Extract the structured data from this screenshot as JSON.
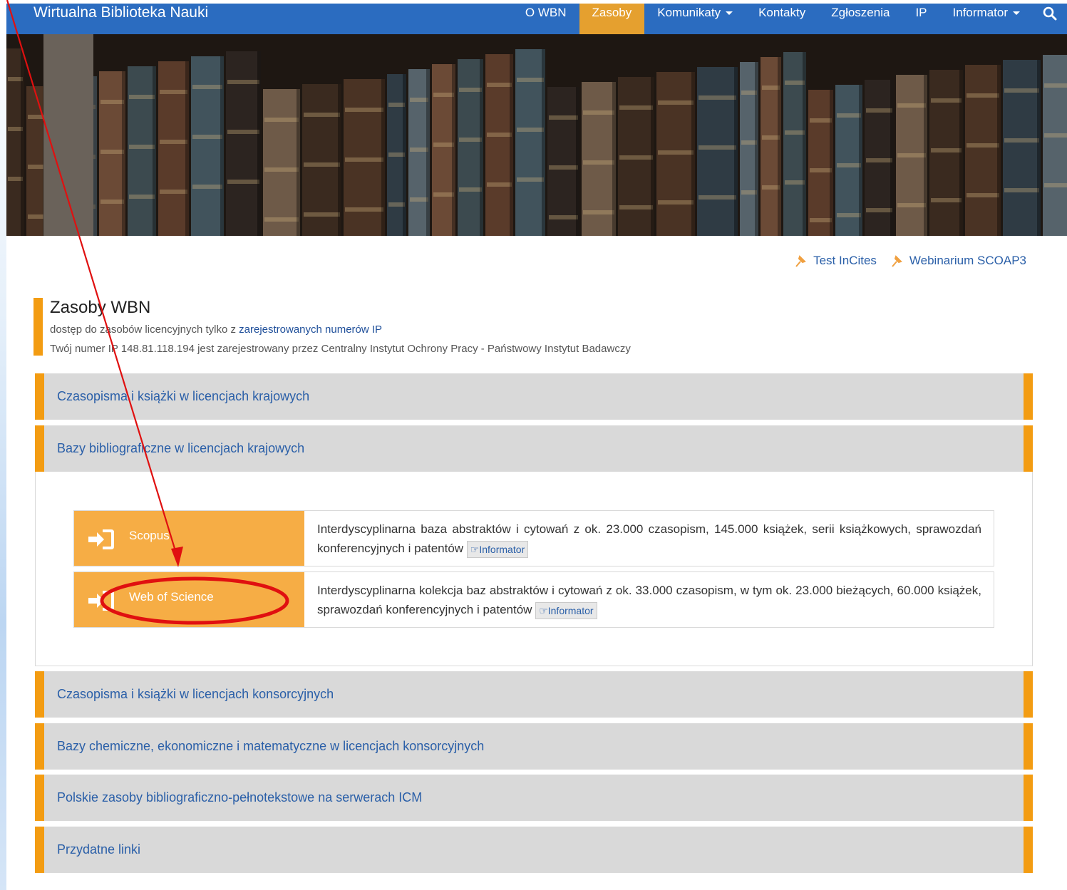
{
  "brand": "Wirtualna Biblioteka Nauki",
  "nav": {
    "items": [
      "O WBN",
      "Zasoby",
      "Komunikaty",
      "Kontakty",
      "Zgłoszenia",
      "IP",
      "Informator"
    ],
    "search_icon": "search-icon"
  },
  "pinned": {
    "link1": "Test InCites",
    "link2": "Webinarium SCOAP3",
    "icon": "pin-icon"
  },
  "section": {
    "title": "Zasoby WBN",
    "sub_prefix": "dostęp do zasobów licencyjnych tylko z ",
    "sub_link": "zarejestrowanych numerów IP",
    "ip_info": "Twój numer IP 148.81.118.194 jest zarejestrowany przez Centralny Instytut Ochrony Pracy - Państwowy Instytut Badawczy"
  },
  "accordion": {
    "item1": "Czasopisma i książki w licencjach krajowych",
    "item2": "Bazy bibliograficzne w licencjach krajowych",
    "item3": "Czasopisma i książki w licencjach konsorcyjnych",
    "item4": "Bazy chemiczne, ekonomiczne i matematyczne w licencjach konsorcyjnych",
    "item5": "Polskie zasoby bibliograficzno-pełnotekstowe na serwerach ICM",
    "item6": "Przydatne linki"
  },
  "resources": {
    "scopus": {
      "name": "Scopus",
      "desc": "Interdyscyplinarna baza abstraktów i cytowań z ok. 23.000 czasopism, 145.000 książek, serii książkowych, sprawozdań konferencyjnych i patentów",
      "info": "Informator"
    },
    "wos": {
      "name": "Web of Science",
      "desc": "Interdyscyplinarna kolekcja baz abstraktów i cytowań z ok. 33.000 czasopism, w tym ok. 23.000 bieżących, 60.000 książek, sprawozdań konferencyjnych i patentów",
      "info": "Informator"
    }
  },
  "colors": {
    "navbar": "#2b6cc0",
    "active": "#e5a02f",
    "accent": "#f39c12",
    "link": "#2a5fa8",
    "annotation": "#e01010"
  }
}
